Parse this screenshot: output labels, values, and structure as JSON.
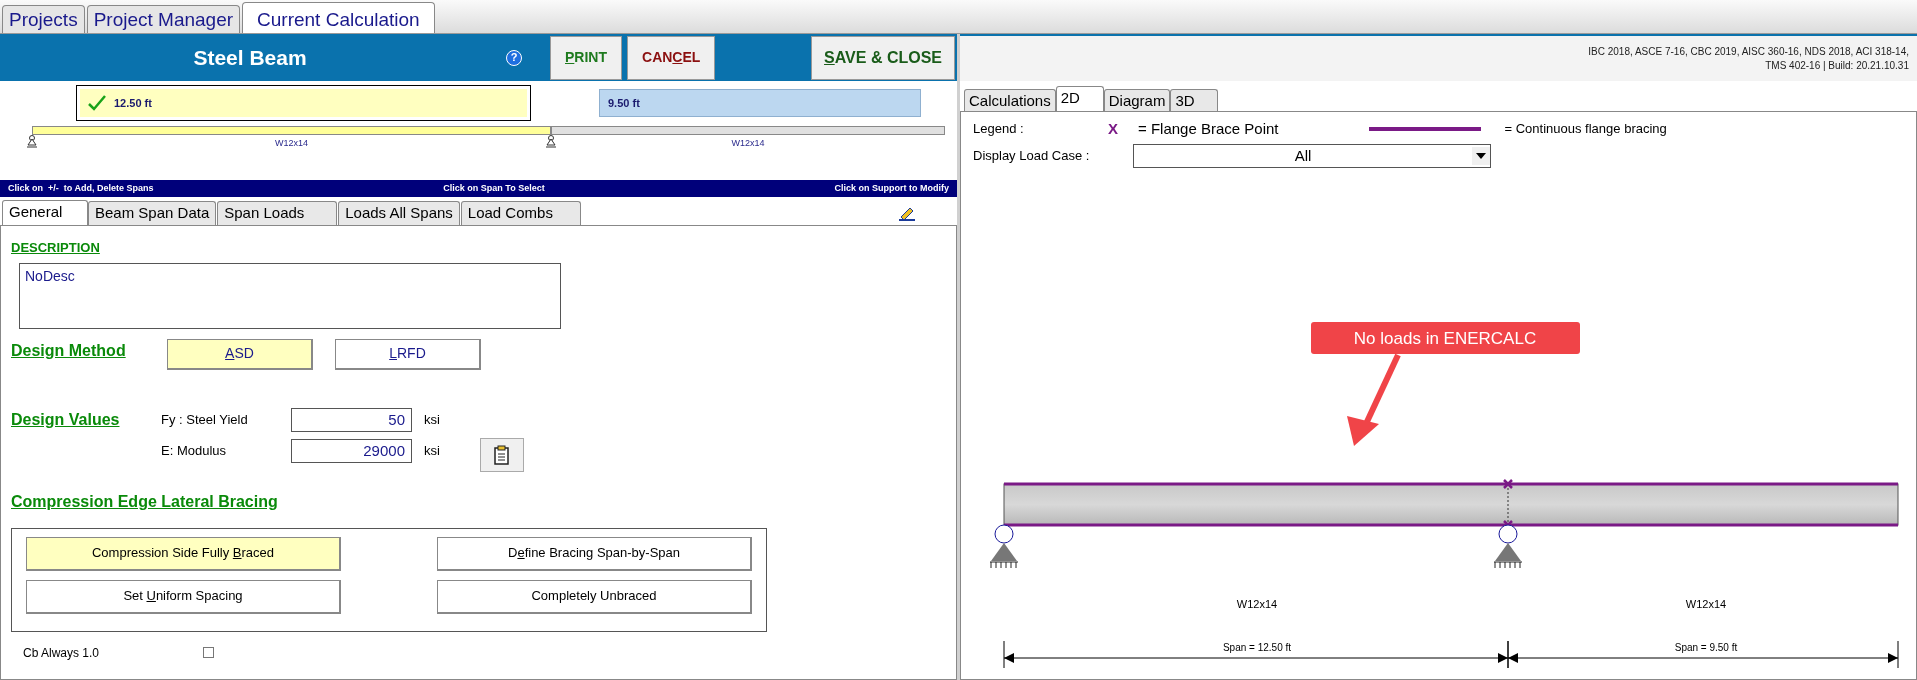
{
  "app_tabs": [
    {
      "label": "Projects",
      "selected": false
    },
    {
      "label": "Project Manager",
      "selected": false
    },
    {
      "label": "Current Calculation",
      "selected": true
    }
  ],
  "header": {
    "title": "Steel Beam",
    "help": "?",
    "buttons": [
      {
        "key": "P",
        "after": "RINT",
        "color": "#1e7a1e"
      },
      {
        "before": "CAN",
        "key": "C",
        "after": "EL",
        "color": "#8b1010"
      }
    ],
    "save_button": {
      "key": "S",
      "after": "AVE & CLOSE",
      "color": "#1a5c1a"
    }
  },
  "build_info": [
    "IBC 2018, ASCE 7-16, CBC 2019, AISC 360-16, NDS 2018, ACI 318-14,",
    "TMS 402-16 | Build: 20.21.10.31"
  ],
  "spans": [
    {
      "length": "12.50 ft",
      "section": "W12x14",
      "selected": true
    },
    {
      "length": "9.50 ft",
      "section": "W12x14",
      "selected": false
    }
  ],
  "hint_bar": [
    "Click on  +/-  to Add, Delete Spans",
    "Click on Span To Select",
    "Click on Support to Modify"
  ],
  "form_tabs": [
    {
      "label": "General",
      "selected": true
    },
    {
      "label": "Beam Span Data",
      "selected": false
    },
    {
      "label": "Span Loads",
      "selected": false
    },
    {
      "label": "Loads All Spans",
      "selected": false
    },
    {
      "label": "Load Combs",
      "selected": false
    }
  ],
  "description": {
    "heading": "DESCRIPTION",
    "value": "NoDesc"
  },
  "design_method": {
    "heading": "Design Method",
    "options": [
      {
        "key": "A",
        "after": "SD",
        "selected": true
      },
      {
        "key": "L",
        "after": "RFD",
        "selected": false
      }
    ]
  },
  "design_values": {
    "heading": "Design Values",
    "fields": [
      {
        "label": "Fy : Steel Yield",
        "value": "50",
        "unit": "ksi"
      },
      {
        "label": "E: Modulus",
        "value": "29000",
        "unit": "ksi"
      }
    ]
  },
  "bracing": {
    "heading": "Compression Edge Lateral Bracing",
    "options": [
      {
        "before": "Compression Side Fully ",
        "key": "B",
        "after": "raced",
        "selected": true
      },
      {
        "before": "D",
        "key": "e",
        "after": "fine Bracing Span-by-Span",
        "selected": false
      },
      {
        "before": "Set ",
        "key": "U",
        "after": "niform Spacing",
        "selected": false
      },
      {
        "after": "Completely Unbraced",
        "selected": false
      }
    ]
  },
  "cb": {
    "label": "Cb Always 1.0",
    "checked": false
  },
  "view_tabs": [
    {
      "label": "Calculations",
      "selected": false
    },
    {
      "label": "2D",
      "selected": true
    },
    {
      "label": "Diagram",
      "selected": false
    },
    {
      "label": "3D",
      "selected": false
    }
  ],
  "legend": {
    "label": "Legend :",
    "mark": "X",
    "brace_point": "= Flange Brace Point",
    "continuous": "= Continuous flange bracing"
  },
  "load_case": {
    "label": "Display Load Case :",
    "value": "All"
  },
  "diagram": {
    "callout": "No loads in ENERCALC",
    "sections": [
      "W12x14",
      "W12x14"
    ],
    "span_labels": [
      "Span = 12.50 ft",
      "Span = 9.50 ft"
    ]
  }
}
